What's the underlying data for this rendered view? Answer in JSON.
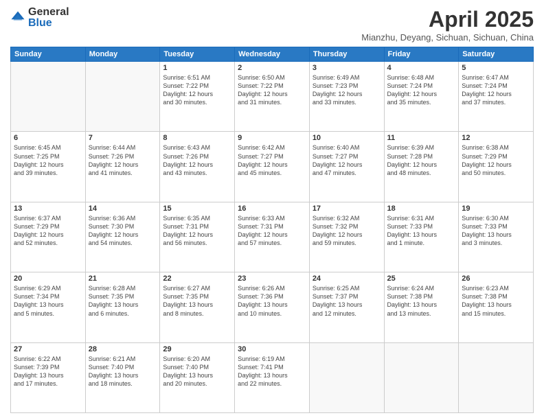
{
  "header": {
    "logo_general": "General",
    "logo_blue": "Blue",
    "month_title": "April 2025",
    "location": "Mianzhu, Deyang, Sichuan, Sichuan, China"
  },
  "days_of_week": [
    "Sunday",
    "Monday",
    "Tuesday",
    "Wednesday",
    "Thursday",
    "Friday",
    "Saturday"
  ],
  "weeks": [
    [
      {
        "day": "",
        "text": ""
      },
      {
        "day": "",
        "text": ""
      },
      {
        "day": "1",
        "text": "Sunrise: 6:51 AM\nSunset: 7:22 PM\nDaylight: 12 hours\nand 30 minutes."
      },
      {
        "day": "2",
        "text": "Sunrise: 6:50 AM\nSunset: 7:22 PM\nDaylight: 12 hours\nand 31 minutes."
      },
      {
        "day": "3",
        "text": "Sunrise: 6:49 AM\nSunset: 7:23 PM\nDaylight: 12 hours\nand 33 minutes."
      },
      {
        "day": "4",
        "text": "Sunrise: 6:48 AM\nSunset: 7:24 PM\nDaylight: 12 hours\nand 35 minutes."
      },
      {
        "day": "5",
        "text": "Sunrise: 6:47 AM\nSunset: 7:24 PM\nDaylight: 12 hours\nand 37 minutes."
      }
    ],
    [
      {
        "day": "6",
        "text": "Sunrise: 6:45 AM\nSunset: 7:25 PM\nDaylight: 12 hours\nand 39 minutes."
      },
      {
        "day": "7",
        "text": "Sunrise: 6:44 AM\nSunset: 7:26 PM\nDaylight: 12 hours\nand 41 minutes."
      },
      {
        "day": "8",
        "text": "Sunrise: 6:43 AM\nSunset: 7:26 PM\nDaylight: 12 hours\nand 43 minutes."
      },
      {
        "day": "9",
        "text": "Sunrise: 6:42 AM\nSunset: 7:27 PM\nDaylight: 12 hours\nand 45 minutes."
      },
      {
        "day": "10",
        "text": "Sunrise: 6:40 AM\nSunset: 7:27 PM\nDaylight: 12 hours\nand 47 minutes."
      },
      {
        "day": "11",
        "text": "Sunrise: 6:39 AM\nSunset: 7:28 PM\nDaylight: 12 hours\nand 48 minutes."
      },
      {
        "day": "12",
        "text": "Sunrise: 6:38 AM\nSunset: 7:29 PM\nDaylight: 12 hours\nand 50 minutes."
      }
    ],
    [
      {
        "day": "13",
        "text": "Sunrise: 6:37 AM\nSunset: 7:29 PM\nDaylight: 12 hours\nand 52 minutes."
      },
      {
        "day": "14",
        "text": "Sunrise: 6:36 AM\nSunset: 7:30 PM\nDaylight: 12 hours\nand 54 minutes."
      },
      {
        "day": "15",
        "text": "Sunrise: 6:35 AM\nSunset: 7:31 PM\nDaylight: 12 hours\nand 56 minutes."
      },
      {
        "day": "16",
        "text": "Sunrise: 6:33 AM\nSunset: 7:31 PM\nDaylight: 12 hours\nand 57 minutes."
      },
      {
        "day": "17",
        "text": "Sunrise: 6:32 AM\nSunset: 7:32 PM\nDaylight: 12 hours\nand 59 minutes."
      },
      {
        "day": "18",
        "text": "Sunrise: 6:31 AM\nSunset: 7:33 PM\nDaylight: 13 hours\nand 1 minute."
      },
      {
        "day": "19",
        "text": "Sunrise: 6:30 AM\nSunset: 7:33 PM\nDaylight: 13 hours\nand 3 minutes."
      }
    ],
    [
      {
        "day": "20",
        "text": "Sunrise: 6:29 AM\nSunset: 7:34 PM\nDaylight: 13 hours\nand 5 minutes."
      },
      {
        "day": "21",
        "text": "Sunrise: 6:28 AM\nSunset: 7:35 PM\nDaylight: 13 hours\nand 6 minutes."
      },
      {
        "day": "22",
        "text": "Sunrise: 6:27 AM\nSunset: 7:35 PM\nDaylight: 13 hours\nand 8 minutes."
      },
      {
        "day": "23",
        "text": "Sunrise: 6:26 AM\nSunset: 7:36 PM\nDaylight: 13 hours\nand 10 minutes."
      },
      {
        "day": "24",
        "text": "Sunrise: 6:25 AM\nSunset: 7:37 PM\nDaylight: 13 hours\nand 12 minutes."
      },
      {
        "day": "25",
        "text": "Sunrise: 6:24 AM\nSunset: 7:38 PM\nDaylight: 13 hours\nand 13 minutes."
      },
      {
        "day": "26",
        "text": "Sunrise: 6:23 AM\nSunset: 7:38 PM\nDaylight: 13 hours\nand 15 minutes."
      }
    ],
    [
      {
        "day": "27",
        "text": "Sunrise: 6:22 AM\nSunset: 7:39 PM\nDaylight: 13 hours\nand 17 minutes."
      },
      {
        "day": "28",
        "text": "Sunrise: 6:21 AM\nSunset: 7:40 PM\nDaylight: 13 hours\nand 18 minutes."
      },
      {
        "day": "29",
        "text": "Sunrise: 6:20 AM\nSunset: 7:40 PM\nDaylight: 13 hours\nand 20 minutes."
      },
      {
        "day": "30",
        "text": "Sunrise: 6:19 AM\nSunset: 7:41 PM\nDaylight: 13 hours\nand 22 minutes."
      },
      {
        "day": "",
        "text": ""
      },
      {
        "day": "",
        "text": ""
      },
      {
        "day": "",
        "text": ""
      }
    ]
  ]
}
